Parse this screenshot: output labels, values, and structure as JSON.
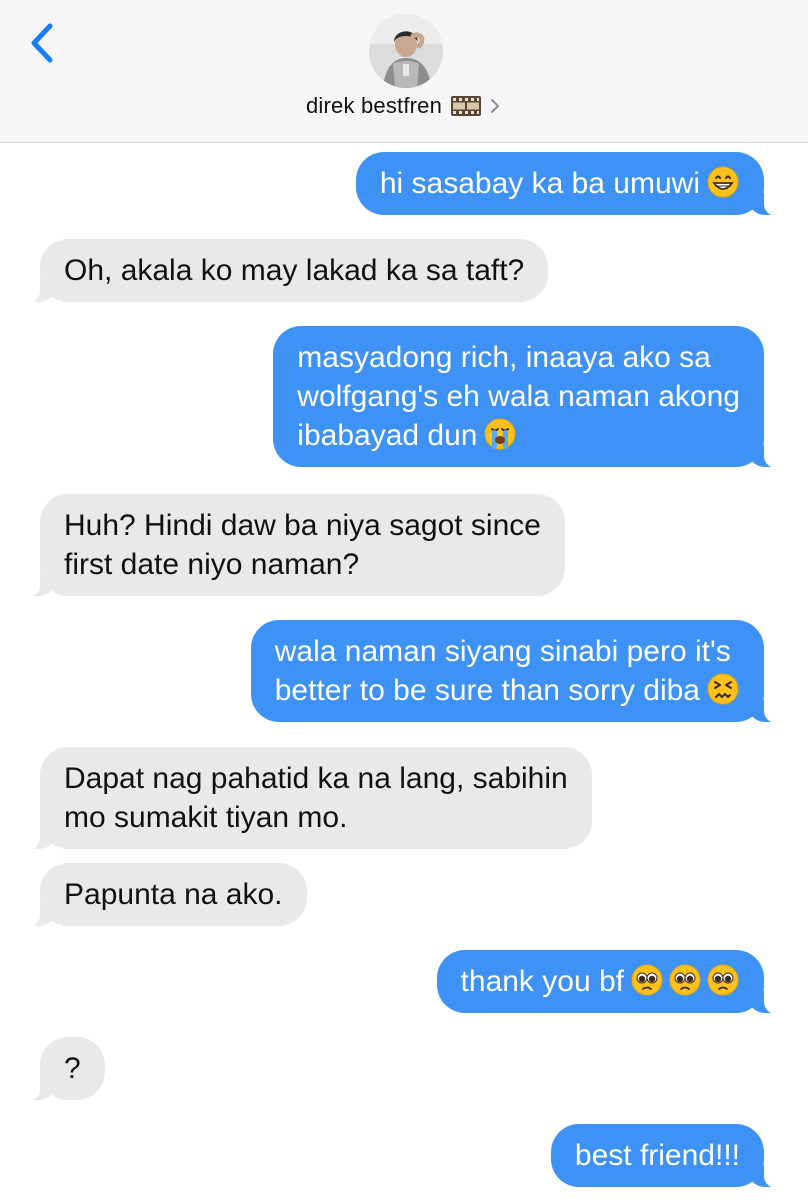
{
  "header": {
    "contact_name": "direk bestfren",
    "contact_emoji": "film-frames-icon",
    "avatar_alt": "contact-photo"
  },
  "colors": {
    "outgoing": "#3e92f5",
    "incoming": "#e9e9eb",
    "accent": "#1a7cf5"
  },
  "messages": [
    {
      "dir": "out",
      "lines": [
        "hi sasabay ka ba umuwi"
      ],
      "emoji": [
        "grinning-face"
      ]
    },
    {
      "dir": "in",
      "lines": [
        "Oh, akala ko may lakad ka sa taft?"
      ]
    },
    {
      "dir": "out",
      "lines": [
        "masyadong rich, inaaya ako sa",
        "wolfgang's eh wala naman akong",
        "ibabayad dun"
      ],
      "emoji": [
        "loudly-crying-face"
      ]
    },
    {
      "dir": "in",
      "lines": [
        "Huh? Hindi daw ba niya sagot since",
        "first date niyo naman?"
      ]
    },
    {
      "dir": "out",
      "lines": [
        "wala naman siyang sinabi pero it's",
        "better to be sure than sorry diba"
      ],
      "emoji": [
        "confounded-face"
      ]
    },
    {
      "dir": "in",
      "lines": [
        "Dapat nag pahatid ka na lang, sabihin",
        "mo sumakit tiyan mo."
      ]
    },
    {
      "dir": "in",
      "lines": [
        "Papunta na ako."
      ]
    },
    {
      "dir": "out",
      "lines": [
        "thank you bf"
      ],
      "emoji": [
        "pleading-face",
        "pleading-face",
        "pleading-face"
      ]
    },
    {
      "dir": "in",
      "lines": [
        "?"
      ]
    },
    {
      "dir": "out",
      "lines": [
        "best friend!!!"
      ]
    }
  ]
}
